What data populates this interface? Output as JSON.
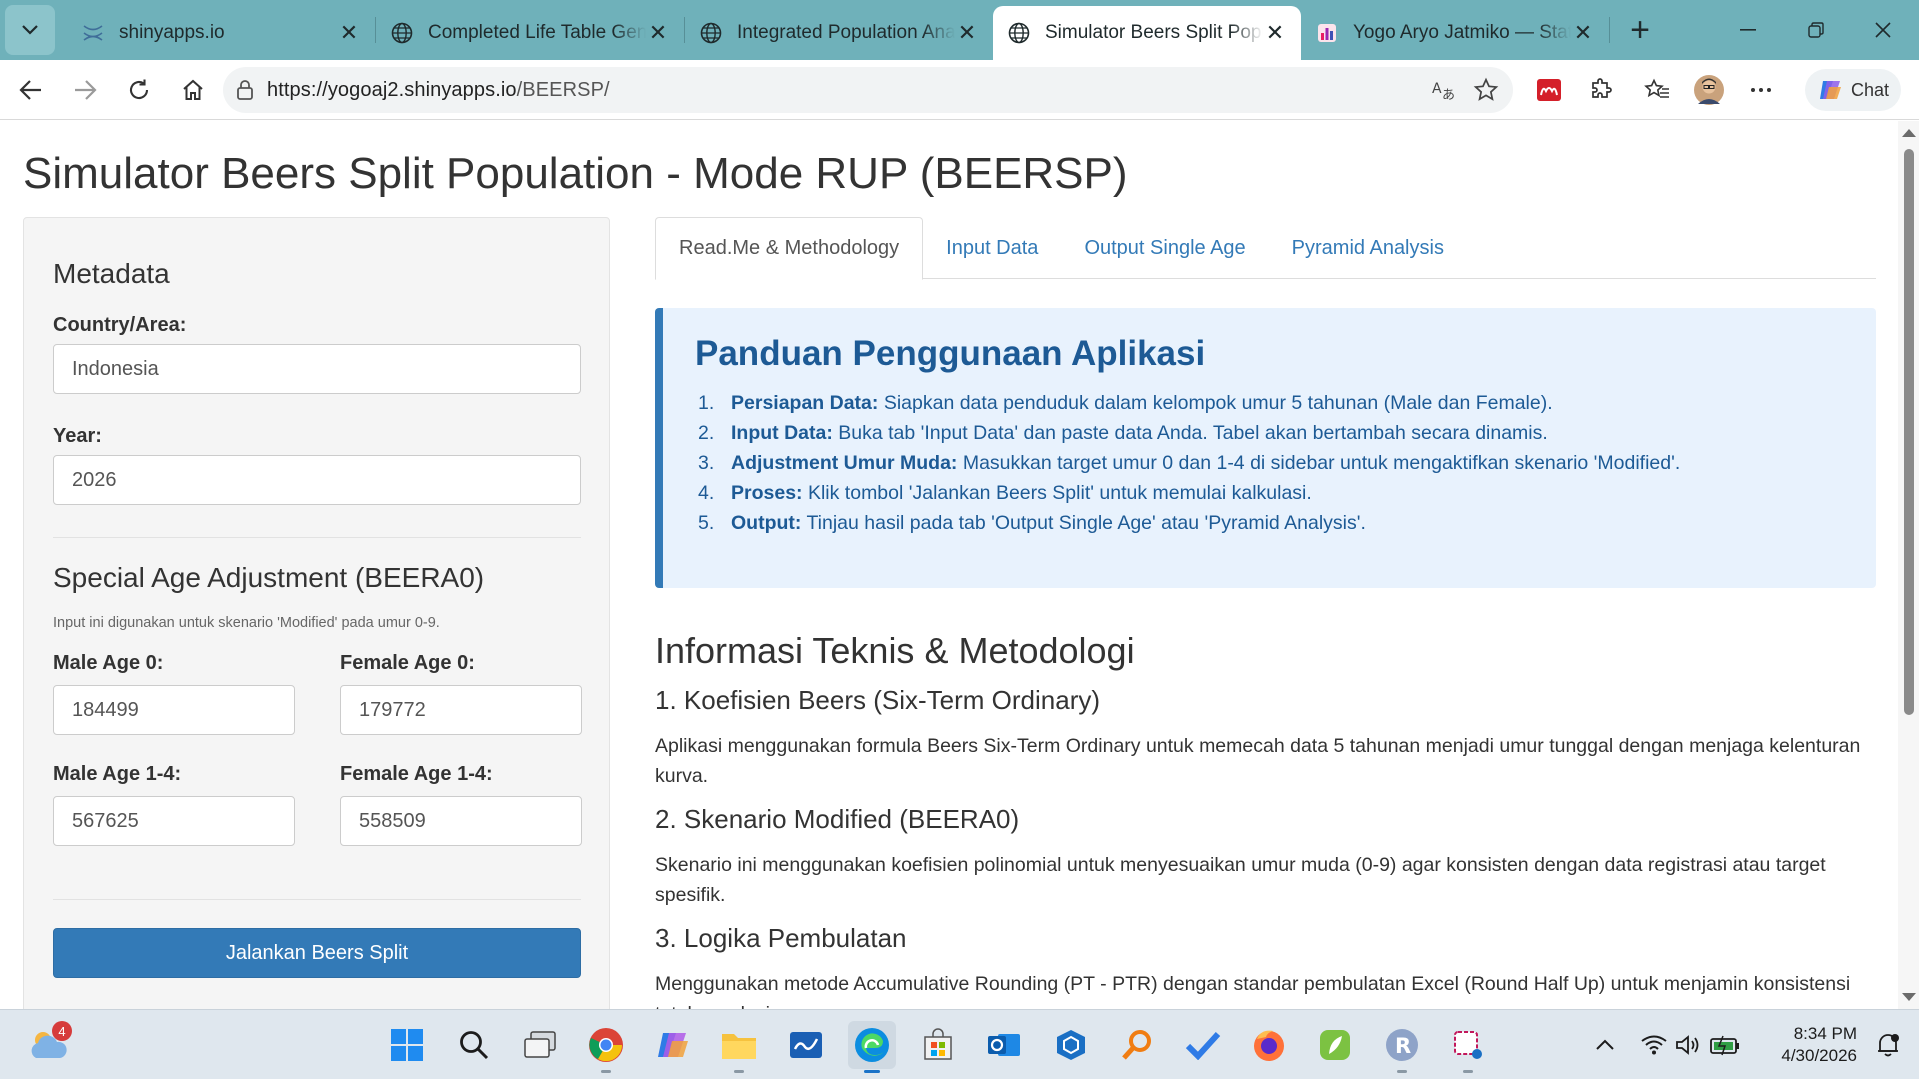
{
  "browser": {
    "tabs": [
      {
        "title": "shinyapps.io",
        "icon": "shinyapps-icon",
        "active": false
      },
      {
        "title": "Completed Life Table Generator",
        "icon": "globe-icon",
        "active": false
      },
      {
        "title": "Integrated Population Analysis",
        "icon": "globe-icon",
        "active": false
      },
      {
        "title": "Simulator Beers Split Population",
        "icon": "globe-icon",
        "active": true
      },
      {
        "title": "Yogo Aryo Jatmiko — Statistician",
        "icon": "chart-favicon-icon",
        "active": false
      }
    ],
    "url_host": "https://yogoaj2.shinyapps.io",
    "url_path": "/BEERSP/",
    "chat_label": "Chat"
  },
  "app": {
    "title": "Simulator Beers Split Population - Mode RUP (BEERSP)"
  },
  "sidebar": {
    "metadata_heading": "Metadata",
    "country_label": "Country/Area:",
    "country_value": "Indonesia",
    "year_label": "Year:",
    "year_value": "2026",
    "special_heading": "Special Age Adjustment (BEERA0)",
    "special_help": "Input ini digunakan untuk skenario 'Modified' pada umur 0-9.",
    "male_age0_label": "Male Age 0:",
    "male_age0_value": "184499",
    "female_age0_label": "Female Age 0:",
    "female_age0_value": "179772",
    "male_age14_label": "Male Age 1-4:",
    "male_age14_value": "567625",
    "female_age14_label": "Female Age 1-4:",
    "female_age14_value": "558509",
    "run_button": "Jalankan Beers Split"
  },
  "main": {
    "tabs": [
      {
        "label": "Read.Me & Methodology",
        "active": true
      },
      {
        "label": "Input Data",
        "active": false
      },
      {
        "label": "Output Single Age",
        "active": false
      },
      {
        "label": "Pyramid Analysis",
        "active": false
      }
    ],
    "guide": {
      "title": "Panduan Penggunaan Aplikasi",
      "steps": [
        {
          "num": "1.",
          "bold": "Persiapan Data:",
          "text": " Siapkan data penduduk dalam kelompok umur 5 tahunan (Male dan Female)."
        },
        {
          "num": "2.",
          "bold": "Input Data:",
          "text": " Buka tab 'Input Data' dan paste data Anda. Tabel akan bertambah secara dinamis."
        },
        {
          "num": "3.",
          "bold": "Adjustment Umur Muda:",
          "text": " Masukkan target umur 0 dan 1-4 di sidebar untuk mengaktifkan skenario 'Modified'."
        },
        {
          "num": "4.",
          "bold": "Proses:",
          "text": " Klik tombol 'Jalankan Beers Split' untuk memulai kalkulasi."
        },
        {
          "num": "5.",
          "bold": "Output:",
          "text": " Tinjau hasil pada tab 'Output Single Age' atau 'Pyramid Analysis'."
        }
      ]
    },
    "info": {
      "heading": "Informasi Teknis & Metodologi",
      "s1_title": "1. Koefisien Beers (Six-Term Ordinary)",
      "s1_text": "Aplikasi menggunakan formula Beers Six-Term Ordinary untuk memecah data 5 tahunan menjadi umur tunggal dengan menjaga kelenturan kurva.",
      "s2_title": "2. Skenario Modified (BEERA0)",
      "s2_text": "Skenario ini menggunakan koefisien polinomial untuk menyesuaikan umur muda (0-9) agar konsisten dengan data registrasi atau target spesifik.",
      "s3_title": "3. Logika Pembulatan",
      "s3_text": "Menggunakan metode Accumulative Rounding (PT - PTR) dengan standar pembulatan Excel (Round Half Up) untuk menjamin konsistensi total populasi."
    }
  },
  "taskbar": {
    "weather_badge": "4",
    "time": "8:34 PM",
    "date": "4/30/2026"
  },
  "colors": {
    "tabbar": "#6fb1ba",
    "primary": "#337ab7",
    "guide_bg": "#e8f2fd",
    "guide_text": "#1d5a95"
  }
}
